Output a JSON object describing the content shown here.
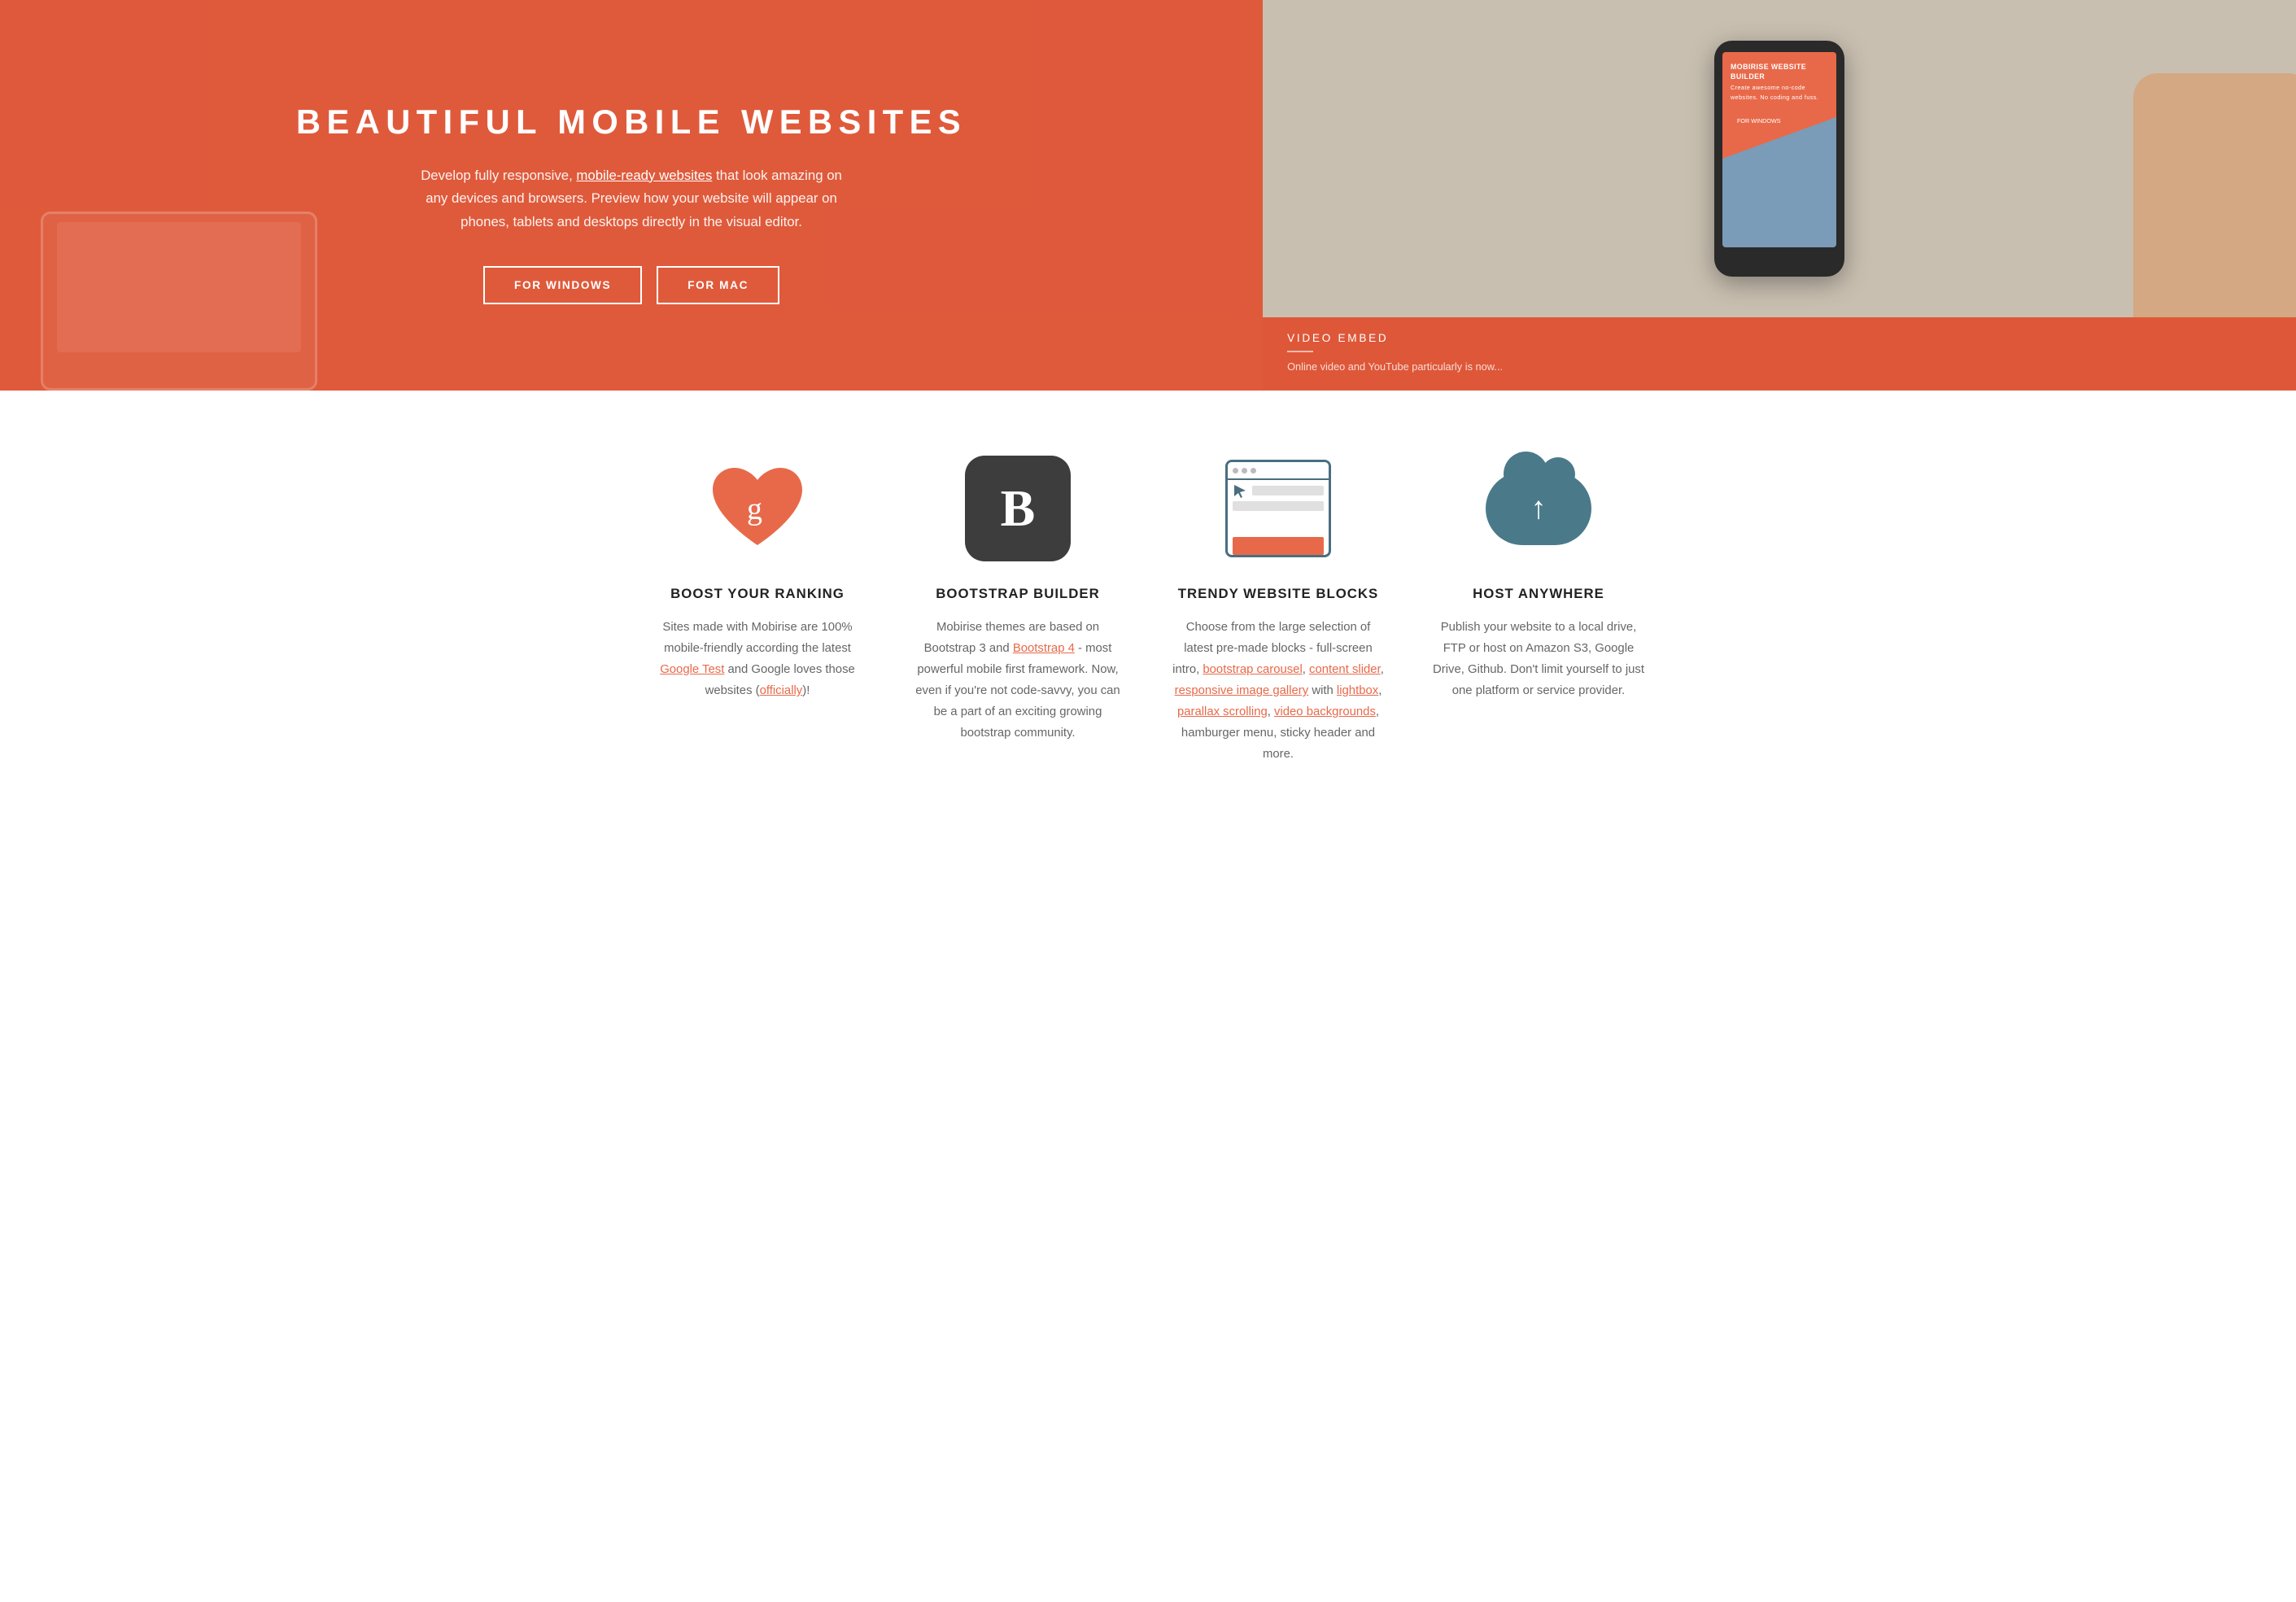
{
  "hero": {
    "title": "BEAUTIFUL MOBILE WEBSITES",
    "description_start": "Develop fully responsive, ",
    "description_link": "mobile-ready websites",
    "description_end": " that look amazing on any devices and browsers. Preview how your website will appear on phones, tablets and desktops directly in the visual editor.",
    "btn_windows": "FOR WINDOWS",
    "btn_mac": "FOR MAC",
    "phone_title": "MOBIRISE WEBSITE BUILDER",
    "phone_subtitle": "Create awesome no-code websites. No coding and fuss.",
    "phone_btn": "FOR WINDOWS",
    "video_label": "VIDEO EMBED",
    "video_desc": "Online video and YouTube particularly is now..."
  },
  "features": [
    {
      "id": "ranking",
      "title": "BOOST YOUR RANKING",
      "desc_start": "Sites made with Mobirise are 100% mobile-friendly according the latest ",
      "link1_text": "Google Test",
      "link1_href": "#",
      "desc_mid": " and Google loves those websites (",
      "link2_text": "officially",
      "link2_href": "#",
      "desc_end": ")!",
      "icon": "heart-google"
    },
    {
      "id": "bootstrap",
      "title": "BOOTSTRAP BUILDER",
      "desc_start": "Mobirise themes are based on Bootstrap 3 and ",
      "link1_text": "Bootstrap 4",
      "link1_href": "#",
      "desc_end": " - most powerful mobile first framework. Now, even if you're not code-savvy, you can be a part of an exciting growing bootstrap community.",
      "icon": "bootstrap-b"
    },
    {
      "id": "blocks",
      "title": "TRENDY WEBSITE BLOCKS",
      "desc_start": "Choose from the large selection of latest pre-made blocks - full-screen intro, ",
      "link1_text": "bootstrap carousel",
      "link1_href": "#",
      "desc_comma1": ", ",
      "link2_text": "content slider",
      "link2_href": "#",
      "desc_comma2": ", ",
      "link3_text": "responsive image gallery",
      "link3_href": "#",
      "desc_with": " with ",
      "link4_text": "lightbox",
      "link4_href": "#",
      "desc_comma3": ", ",
      "link5_text": "parallax scrolling",
      "link5_href": "#",
      "desc_comma4": ", ",
      "link6_text": "video backgrounds",
      "link6_href": "#",
      "desc_end": ", hamburger menu, sticky header and more.",
      "icon": "blocks"
    },
    {
      "id": "hosting",
      "title": "HOST ANYWHERE",
      "desc": "Publish your website to a local drive, FTP or host on Amazon S3, Google Drive, Github. Don't limit yourself to just one platform or service provider.",
      "icon": "cloud-upload"
    }
  ]
}
